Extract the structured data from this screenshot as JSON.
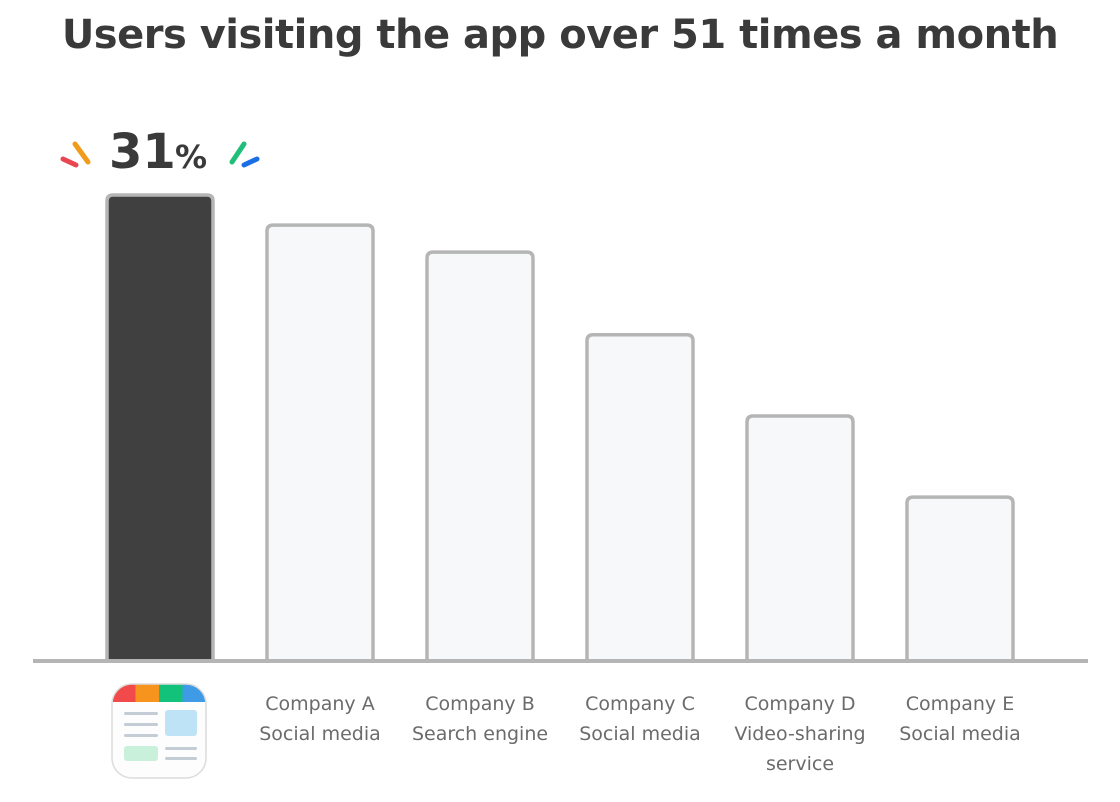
{
  "chart_data": {
    "type": "bar",
    "title": "Users visiting the app over 51 times a month",
    "xlabel": "",
    "ylabel": "",
    "ylim": [
      0,
      31
    ],
    "grid": false,
    "legend": "none",
    "unit": "%",
    "categories": [
      {
        "icon": "app-icon",
        "lines": []
      },
      {
        "lines": [
          "Company A",
          "Social media"
        ]
      },
      {
        "lines": [
          "Company B",
          "Search engine"
        ]
      },
      {
        "lines": [
          "Company C",
          "Social media"
        ]
      },
      {
        "lines": [
          "Company D",
          "Video-sharing",
          "service"
        ]
      },
      {
        "lines": [
          "Company E",
          "Social media"
        ]
      }
    ],
    "values": [
      31,
      29,
      27.2,
      21.7,
      16.3,
      10.9
    ],
    "highlight_index": 0,
    "annotations": [
      {
        "index": 0,
        "value_text": "31",
        "unit_text": "%"
      }
    ]
  },
  "colors": {
    "highlight_fill": "#404040",
    "bar_fill": "#f7f8fa",
    "bar_stroke": "#b5b5b5",
    "axis": "#b5b5b5",
    "spark_left": [
      "#e8474f",
      "#f29a1a"
    ],
    "spark_right": [
      "#1fbf7a",
      "#1a6fe6"
    ],
    "app_icon_stripes": [
      "#f24a4a",
      "#f7941d",
      "#12c27a",
      "#3f9be6"
    ]
  }
}
